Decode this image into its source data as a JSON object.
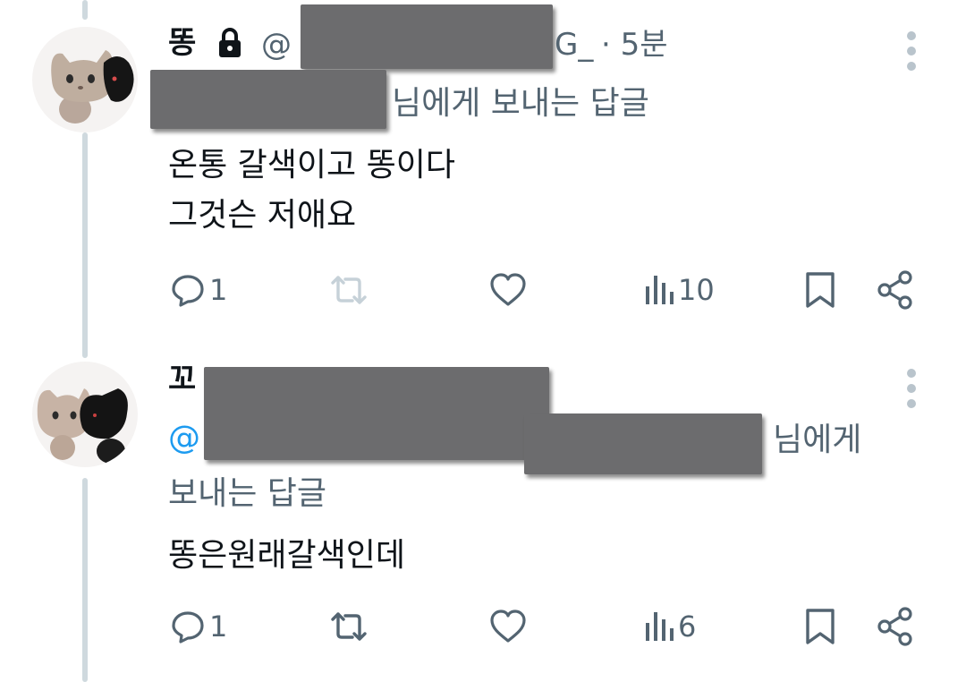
{
  "tweets": [
    {
      "author_name": "똥",
      "handle_visible_start": "@",
      "handle_visible_end": "G_",
      "time": "· 5분",
      "reply_suffix": "님에게 보내는 답글",
      "body_lines": [
        "온통 갈색이고 똥이다",
        "그것슨 저애요"
      ],
      "stats": {
        "replies": "1",
        "retweets": "",
        "likes": "",
        "views": "10"
      }
    },
    {
      "author_name": "꼬",
      "handle_visible_start": "@",
      "reply_suffix_line1": "님에게",
      "reply_suffix_line2": "보내는 답글",
      "body_lines": [
        "똥은원래갈색인데"
      ],
      "stats": {
        "replies": "1",
        "retweets": "",
        "likes": "",
        "views": "6"
      }
    }
  ],
  "icons": {
    "reply": "reply-icon",
    "retweet": "retweet-icon",
    "like": "heart-icon",
    "views": "views-icon",
    "bookmark": "bookmark-icon",
    "share": "share-icon",
    "more": "more-dots-icon",
    "lock": "lock-icon"
  },
  "colors": {
    "text": "#0f1419",
    "secondary": "#536471",
    "mention": "#1d9bf0",
    "thread_line": "#cfd9de",
    "redaction": "#6c6c6e"
  }
}
